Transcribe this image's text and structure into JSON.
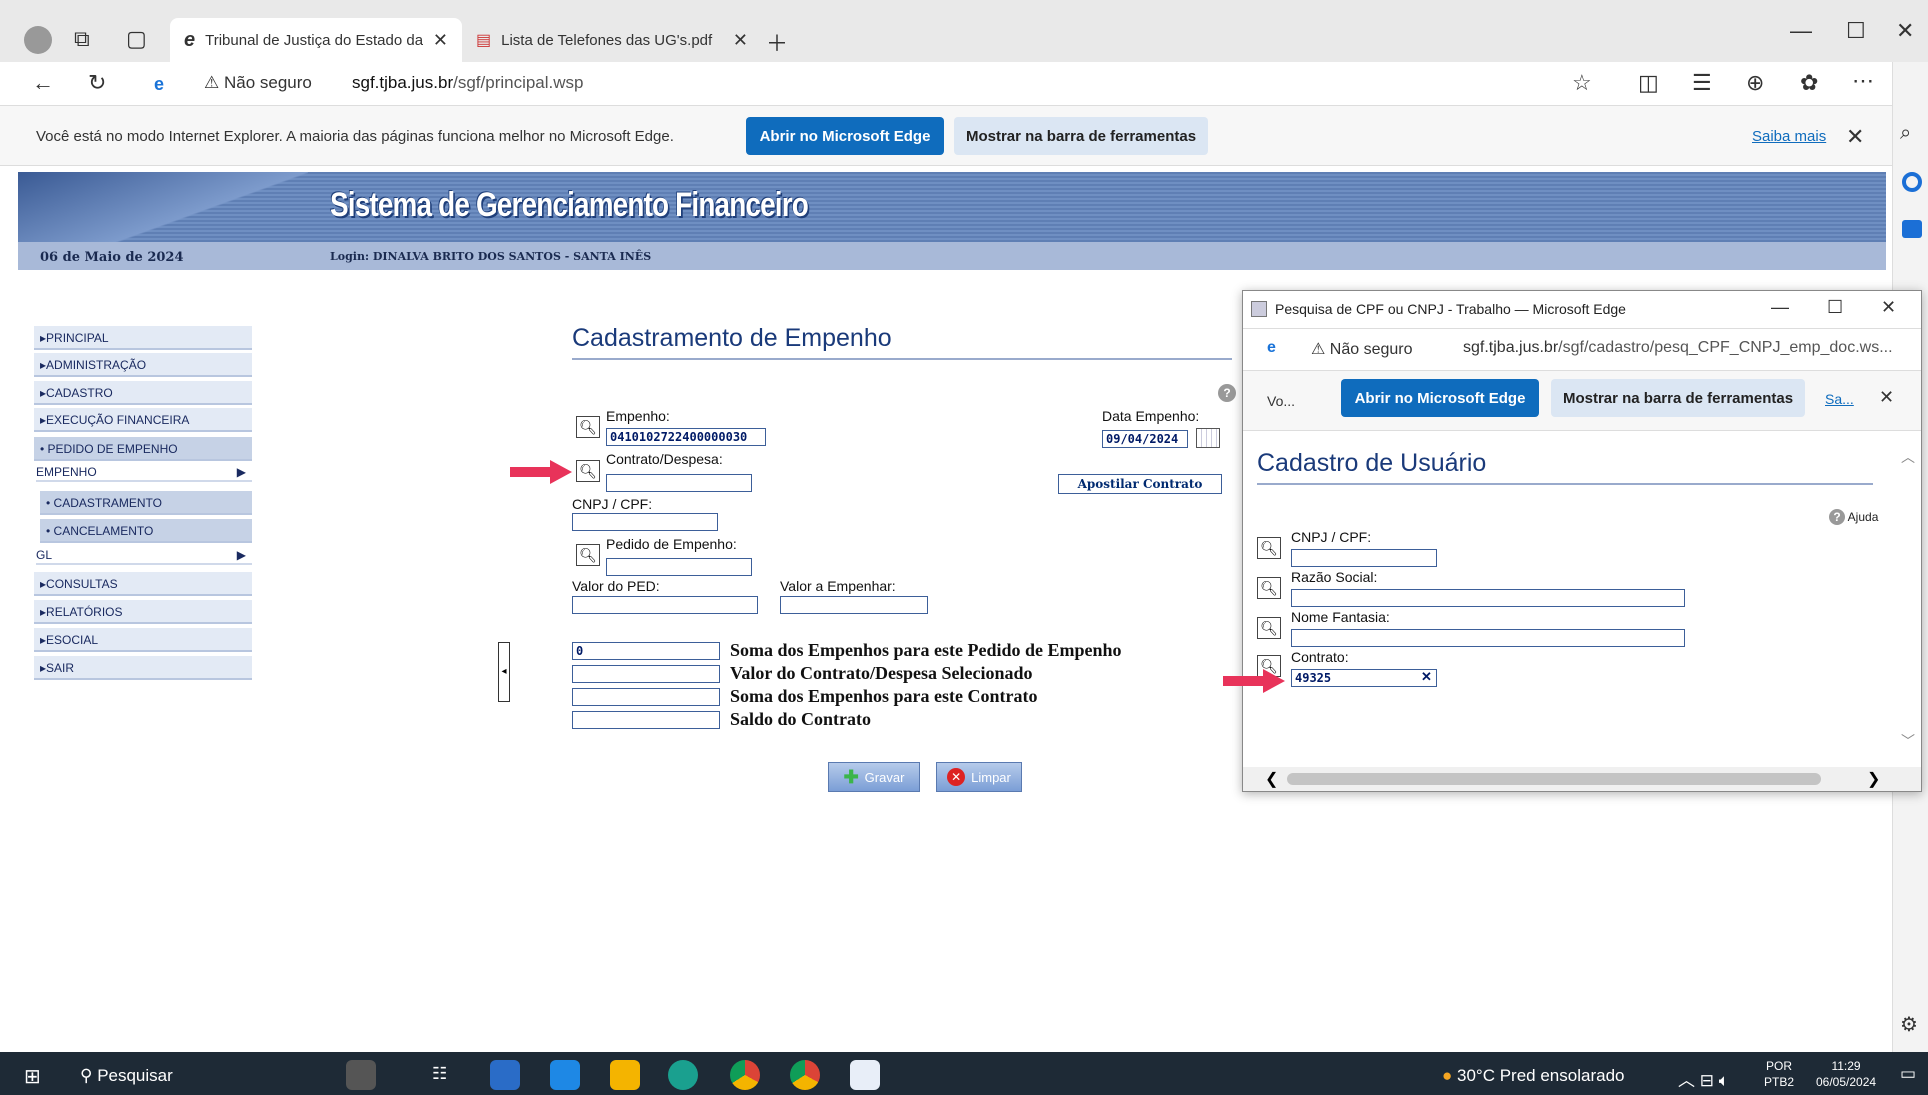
{
  "browser": {
    "tabs": [
      {
        "label": "Tribunal de Justiça do Estado da",
        "icon": "ie-icon"
      },
      {
        "label": "Lista de Telefones das UG's.pdf",
        "icon": "pdf-icon"
      }
    ],
    "security": "Não seguro",
    "url_domain": "sgf.tjba.jus.br",
    "url_path": "/sgf/principal.wsp",
    "ie_message": "Você está no modo Internet Explorer. A maioria das páginas funciona melhor no Microsoft Edge.",
    "open_edge": "Abrir no Microsoft Edge",
    "show_toolbar": "Mostrar na barra de ferramentas",
    "learn_more": "Saiba mais"
  },
  "site": {
    "title": "Sistema de Gerenciamento Financeiro",
    "date": "06 de Maio de 2024",
    "login": "Login: DINALVA BRITO DOS SANTOS - SANTA INÊS"
  },
  "menu": {
    "principal": "PRINCIPAL",
    "administracao": "ADMINISTRAÇÃO",
    "cadastro": "CADASTRO",
    "execucao": "EXECUÇÃO FINANCEIRA",
    "pedido": "PEDIDO DE EMPENHO",
    "empenho": "EMPENHO",
    "cadastramento": "CADASTRAMENTO",
    "cancelamento": "CANCELAMENTO",
    "gl": "GL",
    "consultas": "CONSULTAS",
    "relatorios": "RELATÓRIOS",
    "esocial": "ESOCIAL",
    "sair": "SAIR"
  },
  "form": {
    "title": "Cadastramento de Empenho",
    "empenho_label": "Empenho:",
    "empenho_value": "0410102722400000030",
    "data_label": "Data Empenho:",
    "data_value": "09/04/2024",
    "contrato_label": "Contrato/Despesa:",
    "apostilar": "Apostilar Contrato",
    "cnpj_label": "CNPJ / CPF:",
    "pedido_label": "Pedido de Empenho:",
    "valor_ped_label": "Valor do PED:",
    "valor_empenhar_label": "Valor a Empenhar:",
    "soma_pedido_value": "0",
    "soma_pedido_label": "Soma dos Empenhos para este Pedido de Empenho",
    "valor_contrato_label": "Valor do Contrato/Despesa Selecionado",
    "soma_contrato_label": "Soma dos Empenhos para este Contrato",
    "saldo_label": "Saldo do Contrato",
    "gravar": "Gravar",
    "limpar": "Limpar"
  },
  "popup": {
    "window_title": "Pesquisa de CPF ou CNPJ - Trabalho — Microsoft Edge",
    "security": "Não seguro",
    "url_domain": "sgf.tjba.jus.br",
    "url_path": "/sgf/cadastro/pesq_CPF_CNPJ_emp_doc.ws...",
    "ie_short": "Vo...",
    "open_edge": "Abrir no Microsoft Edge",
    "show_toolbar": "Mostrar na barra de ferramentas",
    "learn_more": "Sa...",
    "title": "Cadastro de Usuário",
    "help": "Ajuda",
    "cnpj_label": "CNPJ / CPF:",
    "razao_label": "Razão Social:",
    "fantasia_label": "Nome Fantasia:",
    "contrato_label": "Contrato:",
    "contrato_value": "49325"
  },
  "taskbar": {
    "search": "Pesquisar",
    "weather": "30°C  Pred ensolarado",
    "lang1": "POR",
    "lang2": "PTB2",
    "time": "11:29",
    "date": "06/05/2024"
  },
  "colors": {
    "accent": "#0f6cbd",
    "arrow": "#e8335a"
  }
}
